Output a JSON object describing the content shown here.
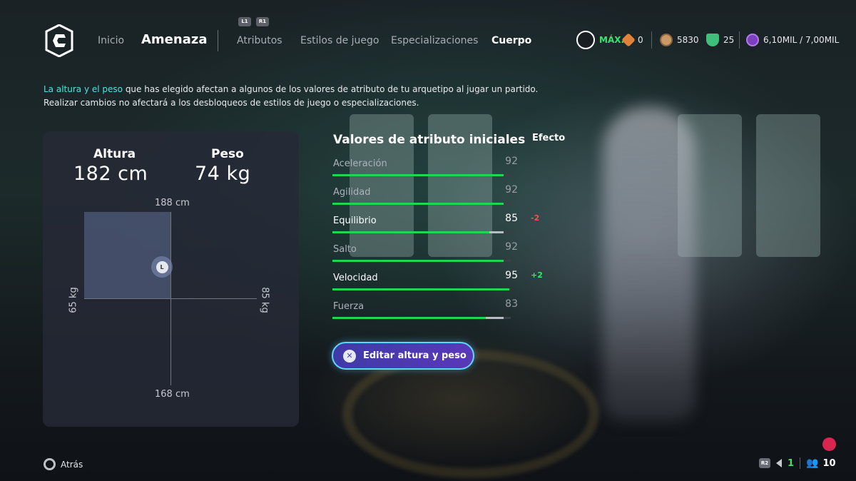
{
  "header": {
    "nav": {
      "inicio": "Inicio",
      "amenaza": "Amenaza",
      "atributos": "Atributos",
      "estilos": "Estilos de juego",
      "especializaciones": "Especializaciones",
      "cuerpo": "Cuerpo"
    },
    "hints": {
      "l1": "L1",
      "r1": "R1"
    },
    "currencies": {
      "max_label": "MÁX.",
      "ap_value": "0",
      "coins_value": "5830",
      "points_value": "25",
      "sp_value": "6,10MIL / 7,00MIL"
    }
  },
  "description": {
    "highlight": "La altura y el peso",
    "line1": " que has elegido afectan a algunos de los valores de atributo de tu arquetipo al jugar un partido.",
    "line2": "Realizar cambios no afectará a los desbloqueos de estilos de juego o especializaciones."
  },
  "body_panel": {
    "height_label": "Altura",
    "height_value": "182 cm",
    "weight_label": "Peso",
    "weight_value": "74 kg",
    "axis_top": "188 cm",
    "axis_bottom": "168 cm",
    "axis_left": "65 kg",
    "axis_right": "85 kg",
    "marker_label": "L"
  },
  "attributes": {
    "title": "Valores de atributo iniciales",
    "effect_title": "Efecto",
    "items": [
      {
        "name": "Aceleración",
        "value": "92",
        "fill": 0.96,
        "effect": "",
        "changed": false
      },
      {
        "name": "Agilidad",
        "value": "92",
        "fill": 0.96,
        "effect": "",
        "changed": false
      },
      {
        "name": "Equilibrio",
        "value": "85",
        "fill": 0.88,
        "prev_fill": 0.96,
        "effect": "-2",
        "changed": true
      },
      {
        "name": "Salto",
        "value": "92",
        "fill": 0.96,
        "effect": "",
        "changed": false
      },
      {
        "name": "Velocidad",
        "value": "95",
        "fill": 0.99,
        "effect": "+2",
        "changed": true
      },
      {
        "name": "Fuerza",
        "value": "83",
        "fill": 0.86,
        "prev_fill": 0.96,
        "effect": "",
        "changed": false
      }
    ]
  },
  "edit_button": {
    "label": "Editar altura y peso",
    "icon": "cross-button-icon"
  },
  "footer": {
    "back_label": "Atrás",
    "r2": "R2",
    "party_count": "1",
    "friends_count": "10"
  },
  "colors": {
    "accent_cyan": "#4fe3e3",
    "bar_green": "#22d35a",
    "negative": "#ff4b4b",
    "positive": "#3be36a",
    "record": "#d9264f"
  }
}
